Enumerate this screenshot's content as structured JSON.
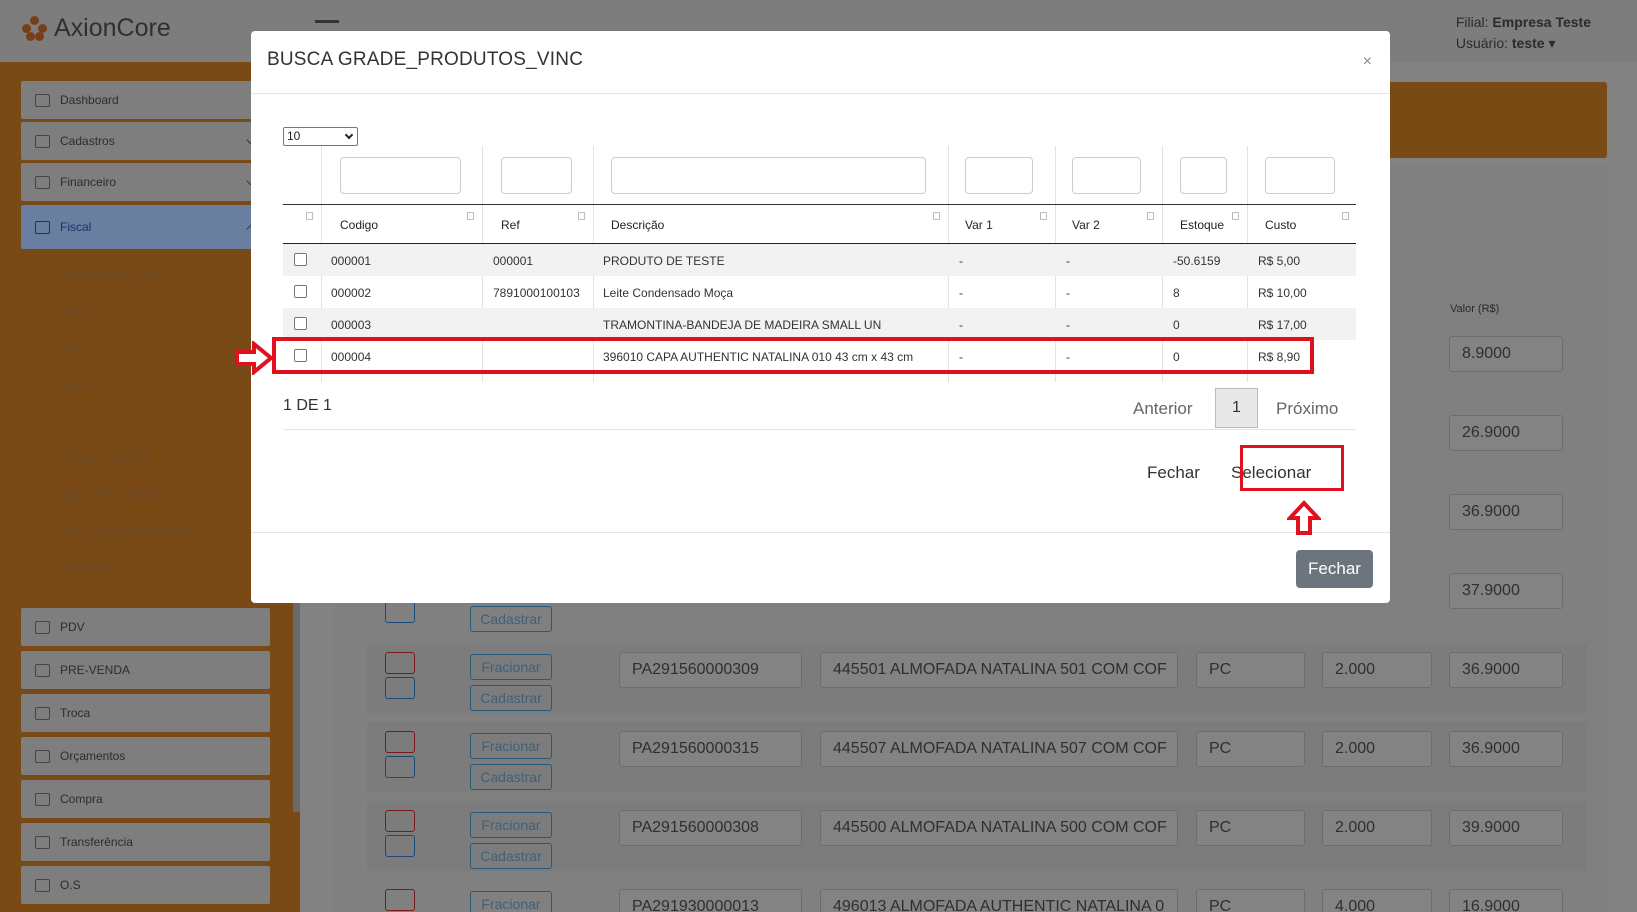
{
  "app": {
    "logo_text": "AxionCore",
    "filial_label": "Filial:",
    "filial_value": "Empresa Teste",
    "usuario_label": "Usuário:",
    "usuario_value": "teste ▾"
  },
  "sidebar": {
    "items": [
      {
        "label": "Dashboard"
      },
      {
        "label": "Cadastros"
      },
      {
        "label": "Financeiro"
      },
      {
        "label": "Fiscal"
      },
      {
        "label": "PDV"
      },
      {
        "label": "PRE-VENDA"
      },
      {
        "label": "Troca"
      },
      {
        "label": "Orçamentos"
      },
      {
        "label": "Compra"
      },
      {
        "label": "Transferência"
      },
      {
        "label": "O.S"
      }
    ],
    "fiscal_sub": [
      "Manifestação (DFe)",
      "NF-e",
      "NFC-e",
      "MDF-e",
      "CT-e",
      "Entrada de NF-e",
      "Sped EFD ICMS IPI",
      "Sped CONTRIBUIÇÕES",
      "Sintegra"
    ]
  },
  "background": {
    "col_valor": "Valor (R$)",
    "valores_top": [
      "8.9000",
      "26.9000",
      "36.9000",
      "37.9000"
    ],
    "btn_fracionar": "Fracionar",
    "btn_cadastrar": "Cadastrar",
    "rows": [
      {
        "codigo": "PA291560000309",
        "descricao": "445501  ALMOFADA NATALINA 501 COM COF",
        "unidade": "PC",
        "qtd": "2.000",
        "valor": "36.9000"
      },
      {
        "codigo": "PA291560000315",
        "descricao": "445507  ALMOFADA NATALINA 507 COM COF",
        "unidade": "PC",
        "qtd": "2.000",
        "valor": "36.9000"
      },
      {
        "codigo": "PA291560000308",
        "descricao": "445500  ALMOFADA NATALINA 500 COM COF",
        "unidade": "PC",
        "qtd": "2.000",
        "valor": "39.9000"
      },
      {
        "codigo": "PA291930000013",
        "descricao": "496013  ALMOFADA AUTHENTIC NATALINA 0",
        "unidade": "PC",
        "qtd": "4.000",
        "valor": "16.9000"
      }
    ]
  },
  "modal": {
    "title": "BUSCA GRADE_PRODUTOS_VINC",
    "close": "×",
    "page_size": "10",
    "columns": [
      "Codigo",
      "Ref",
      "Descrição",
      "Var 1",
      "Var 2",
      "Estoque",
      "Custo"
    ],
    "rows": [
      {
        "codigo": "000001",
        "ref": "000001",
        "descricao": "PRODUTO DE TESTE",
        "var1": "-",
        "var2": "-",
        "estoque": "-50.6159",
        "custo": "R$ 5,00"
      },
      {
        "codigo": "000002",
        "ref": "7891000100103",
        "descricao": "Leite Condensado Moça",
        "var1": "-",
        "var2": "-",
        "estoque": "8",
        "custo": "R$ 10,00"
      },
      {
        "codigo": "000003",
        "ref": "",
        "descricao": "TRAMONTINA-BANDEJA DE MADEIRA SMALL UN",
        "var1": "-",
        "var2": "-",
        "estoque": "0",
        "custo": "R$ 17,00"
      },
      {
        "codigo": "000004",
        "ref": "",
        "descricao": "396010 CAPA AUTHENTIC NATALINA 010 43 cm x 43 cm",
        "var1": "-",
        "var2": "-",
        "estoque": "0",
        "custo": "R$ 8,90"
      }
    ],
    "info": "1 DE 1",
    "pagination": {
      "prev": "Anterior",
      "current": "1",
      "next": "Próximo"
    },
    "btn_fechar": "Fechar",
    "btn_selecionar": "Selecionar",
    "footer_fechar": "Fechar"
  },
  "colors": {
    "highlight": "#e0101f",
    "sidebar": "#7a4a16"
  }
}
